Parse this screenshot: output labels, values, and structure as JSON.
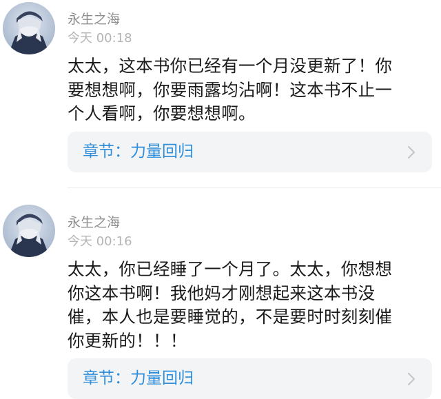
{
  "comments": [
    {
      "username": "永生之海",
      "time": "今天 00:18",
      "lines": [
        "太太，这本书你已经有一个月没更新了！你",
        "要想想啊，你要雨露均沾啊！这本书不止一",
        "个人看啊，你要想想啊。"
      ],
      "chapter": "章节：力量回归"
    },
    {
      "username": "永生之海",
      "time": "今天 00:16",
      "lines": [
        "太太，你已经睡了一个月了。太太，你想想",
        "你这本书啊！我他妈才刚想起来这本书没",
        "催，本人也是要睡觉的，不是要时时刻刻催",
        "你更新的！！！"
      ],
      "chapter": "章节：力量回归"
    }
  ],
  "colors": {
    "accent": "#2f8ed9",
    "username": "#8e8e8e",
    "time": "#b4b4b4",
    "card_bg": "#f3f4f6"
  },
  "icons": {
    "avatar": "anime-avatar-icon",
    "chevron": "chevron-right-icon"
  }
}
